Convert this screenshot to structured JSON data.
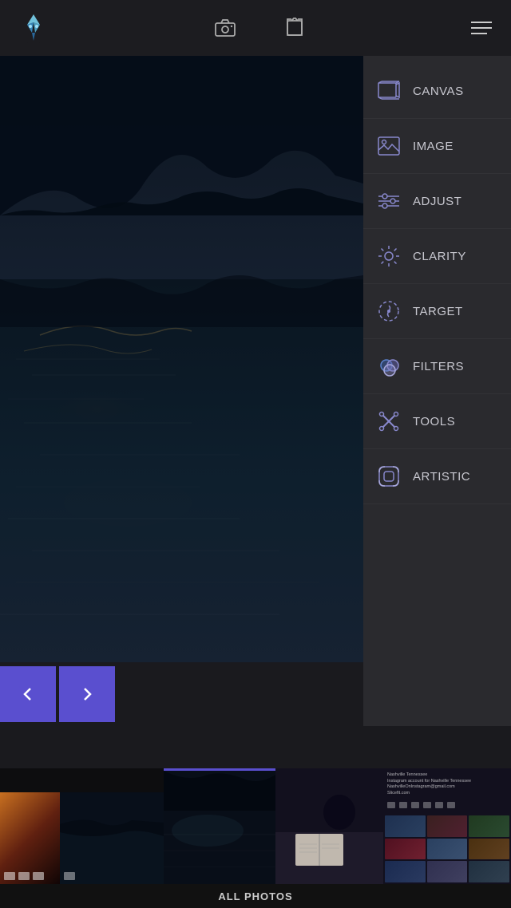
{
  "app": {
    "title": "Pixelmator",
    "logo_alt": "Pixelmator logo"
  },
  "topNav": {
    "camera_icon": "camera",
    "export_icon": "export",
    "menu_icon": "menu"
  },
  "sidebar": {
    "items": [
      {
        "id": "canvas",
        "label": "CANVAS",
        "icon": "canvas-icon"
      },
      {
        "id": "image",
        "label": "IMAGE",
        "icon": "image-icon"
      },
      {
        "id": "adjust",
        "label": "ADJUST",
        "icon": "adjust-icon"
      },
      {
        "id": "clarity",
        "label": "CLARITY",
        "icon": "clarity-icon"
      },
      {
        "id": "target",
        "label": "TARGET",
        "icon": "target-icon"
      },
      {
        "id": "filters",
        "label": "FILTERS",
        "icon": "filters-icon"
      },
      {
        "id": "tools",
        "label": "TOOLS",
        "icon": "tools-icon"
      },
      {
        "id": "artistic",
        "label": "ARTISTIC",
        "icon": "artistic-icon"
      }
    ]
  },
  "bottomNav": {
    "back_label": "←",
    "forward_label": "→"
  },
  "photoStrip": {
    "all_photos_label": "ALL PHOTOS",
    "thumb_text": "Nashville Tennessee\nInstagram account for Nashville Tennessee\nNashvilleOnInstagram@gmail.com\nSlicefit.com"
  }
}
